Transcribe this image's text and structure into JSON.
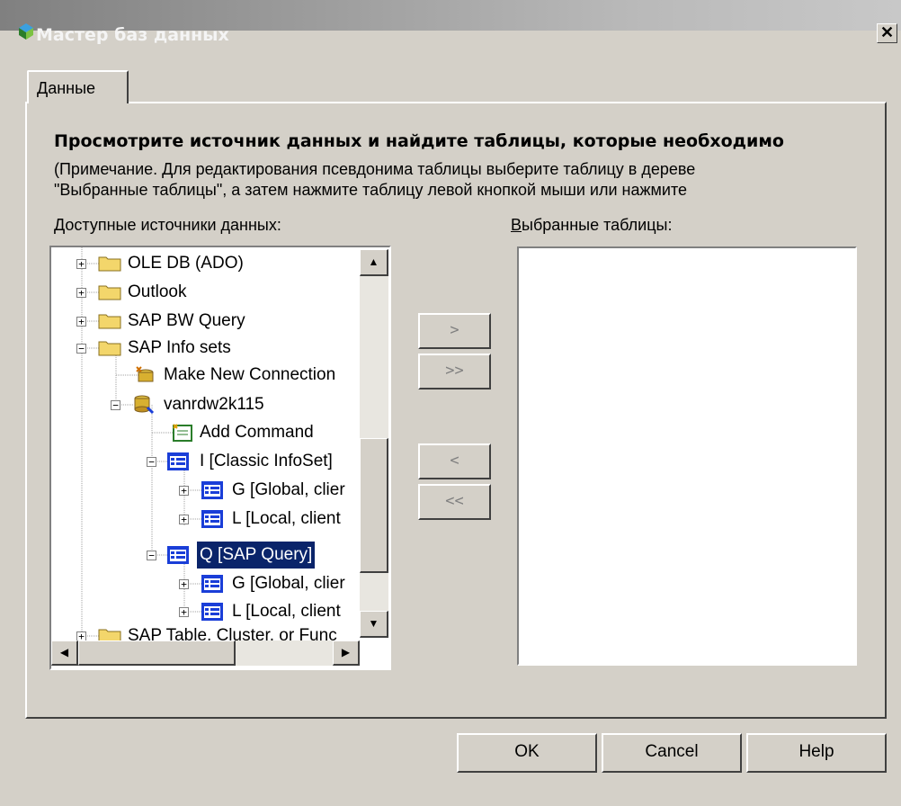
{
  "window": {
    "title": "Мастер баз данных",
    "close_glyph": "✕"
  },
  "tab": {
    "label": "Данные"
  },
  "content": {
    "heading": "Просмотрите источник данных и найдите таблицы, которые необходимо",
    "note_line1": "(Примечание. Для редактирования псевдонима таблицы выберите таблицу в дереве",
    "note_line2": "\"Выбранные таблицы\", а затем нажмите таблицу левой кнопкой мыши или нажмите",
    "available_label": "Доступные источники данных:",
    "available_label_underline": "Д",
    "available_label_rest": "оступные источники данных:",
    "selected_label_underline": "В",
    "selected_label_rest": "ыбранные таблицы:"
  },
  "tree": {
    "items": [
      {
        "label": "OLE DB (ADO)",
        "icon": "folder-icon",
        "expander": "+"
      },
      {
        "label": "Outlook",
        "icon": "folder-icon",
        "expander": "+"
      },
      {
        "label": "SAP BW Query",
        "icon": "folder-icon",
        "expander": "+"
      },
      {
        "label": "SAP Info sets",
        "icon": "folder-icon",
        "expander": "−"
      },
      {
        "label": "Make New Connection",
        "icon": "new-connection-icon",
        "expander": ""
      },
      {
        "label": "vanrdw2k115",
        "icon": "database-icon",
        "expander": "−"
      },
      {
        "label": "Add Command",
        "icon": "add-command-icon",
        "expander": ""
      },
      {
        "label": "I [Classic InfoSet]",
        "icon": "table-icon",
        "expander": "−"
      },
      {
        "label": "G  [Global, clier",
        "icon": "table-icon",
        "expander": "+"
      },
      {
        "label": "L  [Local, client",
        "icon": "table-icon",
        "expander": "+"
      },
      {
        "label": "Q [SAP Query]",
        "icon": "table-icon",
        "expander": "−",
        "selected": true
      },
      {
        "label": "G  [Global, clier",
        "icon": "table-icon",
        "expander": "+"
      },
      {
        "label": "L  [Local, client",
        "icon": "table-icon",
        "expander": "+"
      },
      {
        "label": "SAP Table, Cluster, or Func",
        "icon": "folder-icon",
        "expander": "+"
      }
    ]
  },
  "move_buttons": {
    "add": ">",
    "add_all": ">>",
    "remove": "<",
    "remove_all": "<<"
  },
  "buttons": {
    "ok": "OK",
    "cancel": "Cancel",
    "help": "Help"
  },
  "colors": {
    "face": "#d4d0c8",
    "selection": "#0a246a",
    "folder": "#f3d66b"
  }
}
